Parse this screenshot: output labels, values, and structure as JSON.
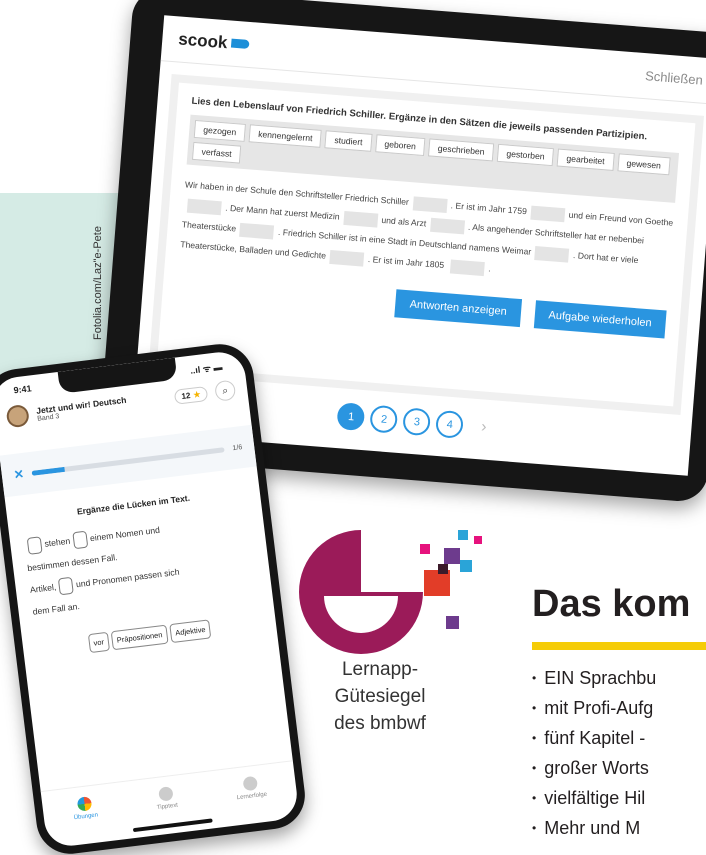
{
  "credit": "Fotolia.com/Laz\"e-Pete",
  "tablet": {
    "brand": "scook",
    "close_label": "Schließen",
    "instruction": "Lies den Lebenslauf von Friedrich Schiller. Ergänze in den Sätzen die jeweils passenden Partizipien.",
    "word_bank": [
      "gezogen",
      "kennengelernt",
      "studiert",
      "geboren",
      "geschrieben",
      "gestorben",
      "gearbeitet",
      "gewesen",
      "verfasst"
    ],
    "passage": {
      "s1": "Wir haben in der Schule den Schriftsteller Friedrich Schiller",
      "s2": ". Er ist im Jahr 1759",
      "s3": "und ein",
      "s4": "Freund von Goethe",
      "s5": ". Der Mann hat zuerst Medizin",
      "s6": "und als Arzt",
      "s7": ". Als angehender",
      "s8": "Schriftsteller hat er nebenbei Theaterstücke",
      "s9": ". Friedrich Schiller ist in eine Stadt in Deutschland namens",
      "s10": "Weimar",
      "s11": ". Dort hat er viele Theaterstücke, Balladen und Gedichte",
      "s12": ". Er ist im Jahr 1805",
      "s13": "."
    },
    "show_answers_button": "Antworten anzeigen",
    "repeat_button": "Aufgabe wiederholen",
    "pages": [
      "1",
      "2",
      "3",
      "4"
    ],
    "next_glyph": "›"
  },
  "phone": {
    "time": "9:41",
    "signal": "..ıl ᯤ ▬",
    "app_title": "Jetzt und wir! Deutsch",
    "subtitle": "Band 3",
    "stars": "12",
    "star_glyph": "★",
    "search_glyph": "⌕",
    "close_glyph": "✕",
    "progress": 0.17,
    "progress_label": "1/6",
    "prompt": "Ergänze die Lücken im Text.",
    "line1_a": "stehen",
    "line1_b": "einem Nomen und",
    "line2": "bestimmen dessen Fall.",
    "line3_a": "Artikel,",
    "line3_b": "und Pronomen passen sich",
    "line4": "dem Fall an.",
    "options": [
      "vor",
      "Präpositionen",
      "Adjektive"
    ],
    "tabs": [
      "Übungen",
      "Tipptext",
      "Lernerfolge"
    ]
  },
  "seal": {
    "line1": "Lernapp-",
    "line2": "Gütesiegel",
    "line3": "des bmbwf",
    "colors": {
      "magenta": "#9b1b59",
      "red": "#e23d28",
      "blue": "#2aa4d8",
      "pink": "#e6127d",
      "purple": "#6d3b8d"
    }
  },
  "right": {
    "heading": "Das kom",
    "features": [
      "EIN Sprachbu",
      "mit Profi-Aufg",
      "fünf Kapitel -",
      "großer Worts",
      "vielfältige Hil",
      "Mehr und M"
    ]
  },
  "colors": {
    "accent": "#2a95e0",
    "mint": "#d5ebe5",
    "yellow": "#f5cc07"
  }
}
